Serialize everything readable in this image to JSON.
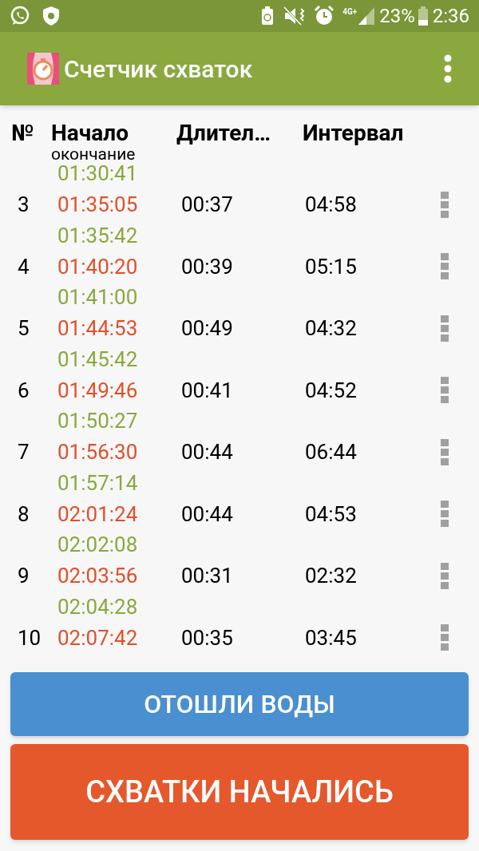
{
  "status_bar": {
    "network": "4G+",
    "battery": "23%",
    "time": "2:36"
  },
  "app_bar": {
    "title": "Счетчик схваток"
  },
  "table": {
    "columns": [
      {
        "label": "№"
      },
      {
        "label": "Начало",
        "sublabel": "окончание"
      },
      {
        "label": "Длител…"
      },
      {
        "label": "Интервал"
      }
    ],
    "top_end": "01:30:41",
    "rows": [
      {
        "number": "3",
        "start": "01:35:05",
        "duration": "00:37",
        "interval": "04:58",
        "end": "01:35:42"
      },
      {
        "number": "4",
        "start": "01:40:20",
        "duration": "00:39",
        "interval": "05:15",
        "end": "01:41:00"
      },
      {
        "number": "5",
        "start": "01:44:53",
        "duration": "00:49",
        "interval": "04:32",
        "end": "01:45:42"
      },
      {
        "number": "6",
        "start": "01:49:46",
        "duration": "00:41",
        "interval": "04:52",
        "end": "01:50:27"
      },
      {
        "number": "7",
        "start": "01:56:30",
        "duration": "00:44",
        "interval": "06:44",
        "end": "01:57:14"
      },
      {
        "number": "8",
        "start": "02:01:24",
        "duration": "00:44",
        "interval": "04:53",
        "end": "02:02:08"
      },
      {
        "number": "9",
        "start": "02:03:56",
        "duration": "00:31",
        "interval": "02:32",
        "end": "02:04:28"
      },
      {
        "number": "10",
        "start": "02:07:42",
        "duration": "00:35",
        "interval": "03:45"
      }
    ]
  },
  "buttons": [
    {
      "label": "ОТОШЛИ ВОДЫ",
      "kind": "secondary"
    },
    {
      "label": "СХВАТКИ НАЧАЛИСЬ",
      "kind": "primary"
    }
  ]
}
